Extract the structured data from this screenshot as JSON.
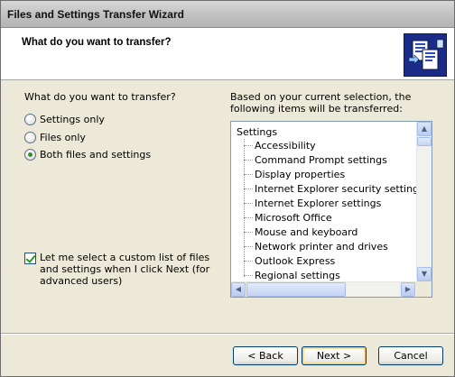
{
  "window": {
    "title": "Files and Settings Transfer Wizard"
  },
  "header": {
    "title": "What do you want to transfer?",
    "icon": "transfer-wizard-icon"
  },
  "left": {
    "prompt": "What do you want to transfer?",
    "options": [
      {
        "label": "Settings only",
        "checked": false
      },
      {
        "label": "Files only",
        "checked": false
      },
      {
        "label": "Both files and settings",
        "checked": true
      }
    ],
    "custom_list": {
      "label": "Let me select a custom list of files and settings when I click Next (for advanced users)",
      "checked": true
    }
  },
  "right": {
    "description": "Based on your current selection, the following items will be transferred:",
    "tree": {
      "root": "Settings",
      "items": [
        "Accessibility",
        "Command Prompt settings",
        "Display properties",
        "Internet Explorer security settings",
        "Internet Explorer settings",
        "Microsoft Office",
        "Mouse and keyboard",
        "Network printer and drives",
        "Outlook Express",
        "Regional settings"
      ]
    }
  },
  "buttons": {
    "back": "< Back",
    "next": "Next >",
    "cancel": "Cancel"
  }
}
